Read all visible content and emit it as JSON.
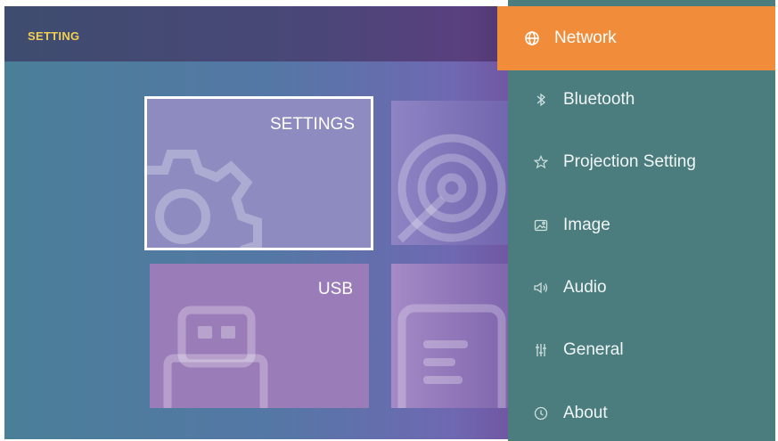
{
  "header": {
    "title": "SETTING"
  },
  "tiles": {
    "settings": {
      "label": "SETTINGS"
    },
    "usb": {
      "label": "USB"
    }
  },
  "menu": {
    "items": [
      {
        "label": "Network",
        "icon": "globe-icon",
        "active": true
      },
      {
        "label": "Bluetooth",
        "icon": "bluetooth-icon"
      },
      {
        "label": "Projection Setting",
        "icon": "star-icon"
      },
      {
        "label": "Image",
        "icon": "image-icon"
      },
      {
        "label": "Audio",
        "icon": "speaker-icon"
      },
      {
        "label": "General",
        "icon": "sliders-icon"
      },
      {
        "label": "About",
        "icon": "info-icon"
      }
    ]
  },
  "colors": {
    "accent": "#f18d3a",
    "menu_bg": "#4c7d7e",
    "title": "#f0cf55"
  }
}
